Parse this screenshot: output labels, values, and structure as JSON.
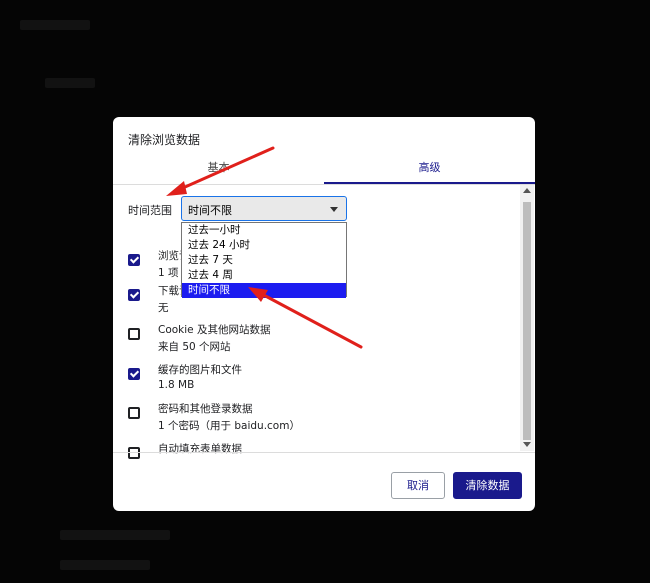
{
  "dialog": {
    "title": "清除浏览数据",
    "tabs": {
      "basic": "基本",
      "advanced": "高级"
    },
    "time_range": {
      "label": "时间范围",
      "selected": "时间不限",
      "options": [
        "过去一小时",
        "过去 24 小时",
        "过去 7 天",
        "过去 4 周",
        "时间不限"
      ]
    },
    "items": [
      {
        "title": "浏览记录",
        "sub": "1 项",
        "checked": true
      },
      {
        "title": "下载记录",
        "sub": "无",
        "checked": true
      },
      {
        "title": "Cookie 及其他网站数据",
        "sub": "来自 50 个网站",
        "checked": false
      },
      {
        "title": "缓存的图片和文件",
        "sub": "1.8 MB",
        "checked": true
      },
      {
        "title": "密码和其他登录数据",
        "sub": "1 个密码（用于 baidu.com）",
        "checked": false
      },
      {
        "title": "自动填充表单数据",
        "sub": "",
        "checked": false
      }
    ],
    "buttons": {
      "cancel": "取消",
      "clear": "清除数据"
    }
  },
  "colors": {
    "accent": "#1a1a8c",
    "arrow": "#e0201b",
    "highlight": "#1c1cf0"
  }
}
